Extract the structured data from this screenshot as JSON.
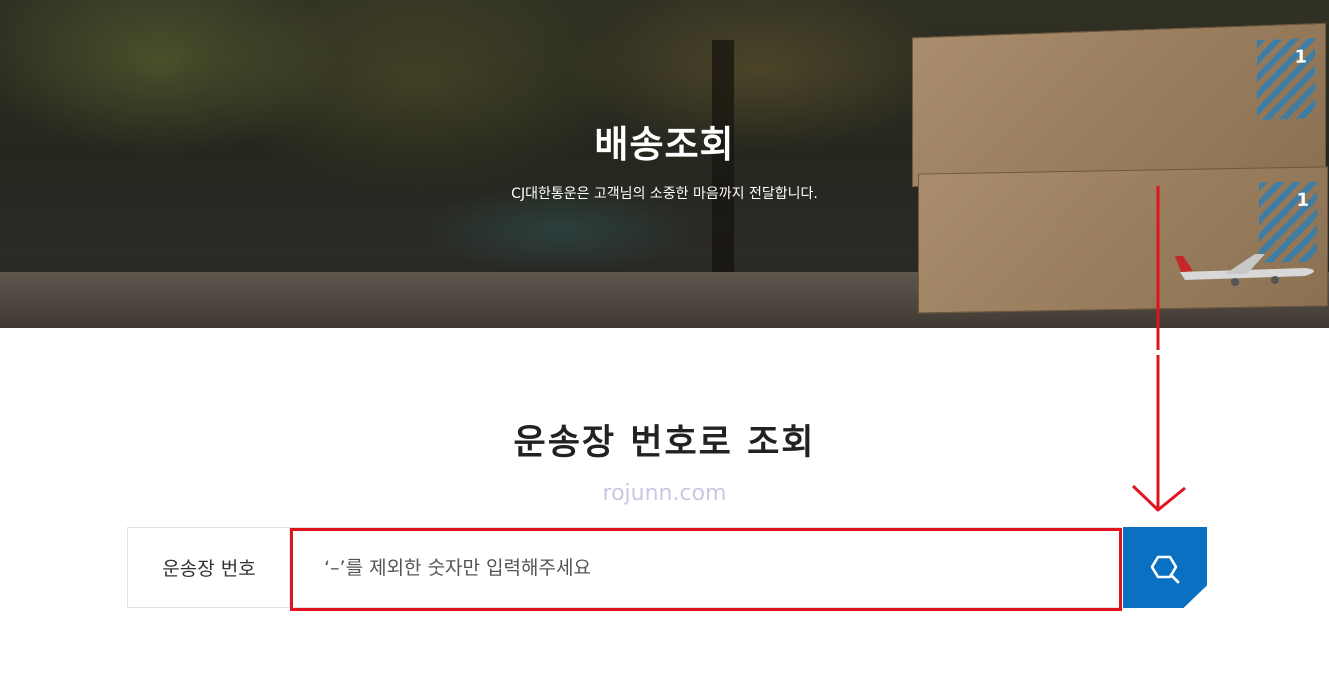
{
  "hero": {
    "title": "배송조회",
    "subtitle": "CJ대한통운은 고객님의 소중한 마음까지 전달합니다."
  },
  "section": {
    "title": "운송장 번호로 조회"
  },
  "watermark": "rojunn.com",
  "search": {
    "label": "운송장 번호",
    "value": "",
    "placeholder": "‘–’를 제외한 숫자만 입력해주세요",
    "button_icon": "search-icon"
  },
  "colors": {
    "accent": "#0a70c2",
    "highlight": "#e0141e"
  }
}
